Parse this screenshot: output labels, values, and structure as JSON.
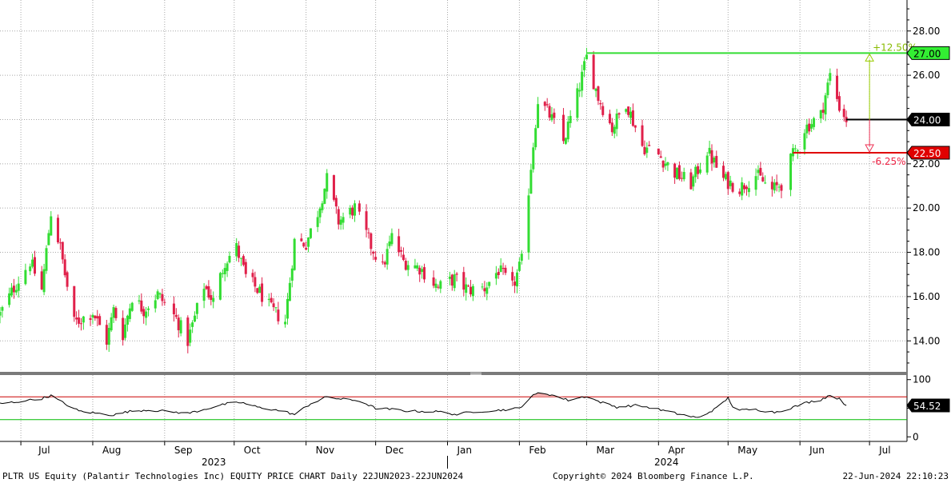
{
  "footer": {
    "title": "PLTR US Equity (Palantir Technologies Inc) EQUITY PRICE CHART  Daily 22JUN2023-22JUN2024",
    "copyright": "Copyright© 2024 Bloomberg Finance L.P.",
    "timestamp": "22-Jun-2024 22:10:23"
  },
  "colors": {
    "up": "#33dd33",
    "down": "#e0204a",
    "target_line": "#33dd33",
    "stop_line": "#e00000",
    "current_line": "#000000",
    "rsi_upper": "#cc0000",
    "rsi_lower": "#00bb00",
    "grid": "#a8a8a8"
  },
  "chart_data": [
    {
      "type": "candlestick",
      "title": "",
      "ylim": [
        12.6,
        29.4
      ],
      "y_ticks": [
        "14.00",
        "16.00",
        "18.00",
        "20.00",
        "22.00",
        "24.00",
        "26.00",
        "28.00"
      ],
      "grid": true,
      "x_months": [
        "Jul",
        "Aug",
        "Sep",
        "Oct",
        "Nov",
        "Dec",
        "Jan",
        "Feb",
        "Mar",
        "Apr",
        "May",
        "Jun",
        "Jul"
      ],
      "x_years": [
        "2023",
        "2024"
      ],
      "close_path": [
        [
          "2023-06-22",
          15.2
        ],
        [
          "2023-06-28",
          16.4
        ],
        [
          "2023-07-05",
          17.6
        ],
        [
          "2023-07-10",
          16.3
        ],
        [
          "2023-07-14",
          19.8
        ],
        [
          "2023-07-18",
          18.2
        ],
        [
          "2023-07-20",
          17.0
        ],
        [
          "2023-07-24",
          14.8
        ],
        [
          "2023-08-01",
          15.3
        ],
        [
          "2023-08-07",
          14.0
        ],
        [
          "2023-08-10",
          15.4
        ],
        [
          "2023-08-14",
          14.3
        ],
        [
          "2023-08-18",
          16.0
        ],
        [
          "2023-08-23",
          15.4
        ],
        [
          "2023-08-29",
          16.1
        ],
        [
          "2023-09-06",
          15.0
        ],
        [
          "2023-09-11",
          14.0
        ],
        [
          "2023-09-18",
          16.5
        ],
        [
          "2023-09-22",
          15.8
        ],
        [
          "2023-09-27",
          17.6
        ],
        [
          "2023-10-02",
          18.2
        ],
        [
          "2023-10-06",
          16.9
        ],
        [
          "2023-10-12",
          16.2
        ],
        [
          "2023-10-17",
          15.4
        ],
        [
          "2023-10-23",
          14.9
        ],
        [
          "2023-10-27",
          18.5
        ],
        [
          "2023-11-01",
          18.4
        ],
        [
          "2023-11-06",
          19.8
        ],
        [
          "2023-11-10",
          21.3
        ],
        [
          "2023-11-15",
          19.4
        ],
        [
          "2023-11-22",
          20.0
        ],
        [
          "2023-11-29",
          18.3
        ],
        [
          "2023-12-04",
          17.3
        ],
        [
          "2023-12-08",
          18.7
        ],
        [
          "2023-12-13",
          17.6
        ],
        [
          "2023-12-20",
          17.3
        ],
        [
          "2023-12-28",
          16.4
        ],
        [
          "2024-01-04",
          16.8
        ],
        [
          "2024-01-10",
          16.3
        ],
        [
          "2024-01-17",
          16.4
        ],
        [
          "2024-01-23",
          17.2
        ],
        [
          "2024-01-29",
          16.4
        ],
        [
          "2024-02-02",
          17.6
        ],
        [
          "2024-02-06",
          21.9
        ],
        [
          "2024-02-09",
          24.9
        ],
        [
          "2024-02-14",
          24.2
        ],
        [
          "2024-02-20",
          23.0
        ],
        [
          "2024-02-26",
          25.1
        ],
        [
          "2024-03-01",
          26.8
        ],
        [
          "2024-03-06",
          25.0
        ],
        [
          "2024-03-12",
          23.6
        ],
        [
          "2024-03-18",
          24.8
        ],
        [
          "2024-03-25",
          22.8
        ],
        [
          "2024-04-01",
          22.4
        ],
        [
          "2024-04-08",
          21.6
        ],
        [
          "2024-04-15",
          21.1
        ],
        [
          "2024-04-22",
          22.6
        ],
        [
          "2024-04-29",
          21.3
        ],
        [
          "2024-05-06",
          20.9
        ],
        [
          "2024-05-13",
          21.5
        ],
        [
          "2024-05-20",
          20.8
        ],
        [
          "2024-05-24",
          21.1
        ],
        [
          "2024-05-29",
          22.4
        ],
        [
          "2024-06-03",
          23.6
        ],
        [
          "2024-06-10",
          24.2
        ],
        [
          "2024-06-14",
          26.0
        ],
        [
          "2024-06-18",
          24.6
        ],
        [
          "2024-06-21",
          24.0
        ]
      ],
      "annotations": {
        "target": {
          "value": 27.0,
          "label": "27.00",
          "start": "2024-03-01",
          "pct_label": "+12.50%"
        },
        "current": {
          "value": 24.0,
          "label": "24.00",
          "start": "2024-06-21"
        },
        "stop": {
          "value": 22.5,
          "label": "22.50",
          "start": "2024-05-29",
          "pct_label": "-6.25%"
        },
        "arrow_date": "2024-07-01"
      }
    },
    {
      "type": "line",
      "title": "",
      "series": [
        {
          "name": "",
          "last_label": "54.52"
        }
      ],
      "ylim": [
        -8,
        108
      ],
      "y_ticks": [
        "100",
        "50",
        "0"
      ],
      "upper_level": 70,
      "lower_level": 30,
      "rsi_path": [
        [
          "2023-06-22",
          58
        ],
        [
          "2023-07-01",
          62
        ],
        [
          "2023-07-10",
          67
        ],
        [
          "2023-07-14",
          72
        ],
        [
          "2023-07-19",
          60
        ],
        [
          "2023-07-26",
          45
        ],
        [
          "2023-08-03",
          41
        ],
        [
          "2023-08-10",
          38
        ],
        [
          "2023-08-16",
          44
        ],
        [
          "2023-08-24",
          47
        ],
        [
          "2023-09-01",
          45
        ],
        [
          "2023-09-11",
          41
        ],
        [
          "2023-09-20",
          50
        ],
        [
          "2023-09-28",
          58
        ],
        [
          "2023-10-04",
          60
        ],
        [
          "2023-10-12",
          51
        ],
        [
          "2023-10-22",
          45
        ],
        [
          "2023-10-27",
          39
        ],
        [
          "2023-11-03",
          58
        ],
        [
          "2023-11-10",
          70
        ],
        [
          "2023-11-16",
          66
        ],
        [
          "2023-11-24",
          63
        ],
        [
          "2023-12-01",
          50
        ],
        [
          "2023-12-08",
          48
        ],
        [
          "2023-12-15",
          45
        ],
        [
          "2023-12-28",
          44
        ],
        [
          "2024-01-05",
          39
        ],
        [
          "2024-01-12",
          44
        ],
        [
          "2024-01-22",
          46
        ],
        [
          "2024-02-01",
          50
        ],
        [
          "2024-02-06",
          70
        ],
        [
          "2024-02-10",
          78
        ],
        [
          "2024-02-16",
          72
        ],
        [
          "2024-02-22",
          64
        ],
        [
          "2024-03-01",
          71
        ],
        [
          "2024-03-06",
          62
        ],
        [
          "2024-03-14",
          52
        ],
        [
          "2024-03-22",
          55
        ],
        [
          "2024-03-29",
          51
        ],
        [
          "2024-04-05",
          44
        ],
        [
          "2024-04-12",
          38
        ],
        [
          "2024-04-18",
          33
        ],
        [
          "2024-04-26",
          50
        ],
        [
          "2024-05-01",
          68
        ],
        [
          "2024-05-04",
          46
        ],
        [
          "2024-05-12",
          48
        ],
        [
          "2024-05-21",
          43
        ],
        [
          "2024-05-27",
          49
        ],
        [
          "2024-06-04",
          60
        ],
        [
          "2024-06-10",
          65
        ],
        [
          "2024-06-14",
          73
        ],
        [
          "2024-06-18",
          66
        ],
        [
          "2024-06-21",
          55
        ]
      ]
    }
  ]
}
